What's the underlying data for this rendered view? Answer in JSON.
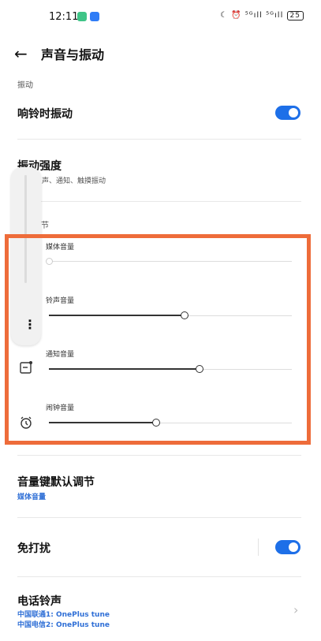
{
  "status": {
    "time": "12:11",
    "right": "☾ ⏰ ⁵ᴳıll ⁵ᴳıll",
    "battery": "25"
  },
  "header": {
    "title": "声音与振动",
    "back_icon": "back-arrow-icon"
  },
  "vibration_section": {
    "label": "振动"
  },
  "ring_vibrate": {
    "title": "响铃时振动",
    "on": true
  },
  "vibration_strength": {
    "title": "振动强度",
    "subtitle": "声、通知、触摸振动"
  },
  "volume_section": {
    "label": "节"
  },
  "sliders": [
    {
      "label": "媒体音量",
      "value": 0.0
    },
    {
      "label": "铃声音量",
      "value": 0.56
    },
    {
      "label": "通知音量",
      "value": 0.62
    },
    {
      "label": "闹钟音量",
      "value": 0.44
    }
  ],
  "volume_key": {
    "title": "音量键默认调节",
    "value": "媒体音量"
  },
  "dnd": {
    "title": "免打扰",
    "on": true
  },
  "ringtone": {
    "title": "电话铃声",
    "line1": "中国联通1: OnePlus tune",
    "line2": "中国电信2: OnePlus tune"
  },
  "colors": {
    "accent": "#1d6fe8",
    "highlight": "#ee6c3a",
    "subtitle_blue": "#2f6fd6"
  }
}
